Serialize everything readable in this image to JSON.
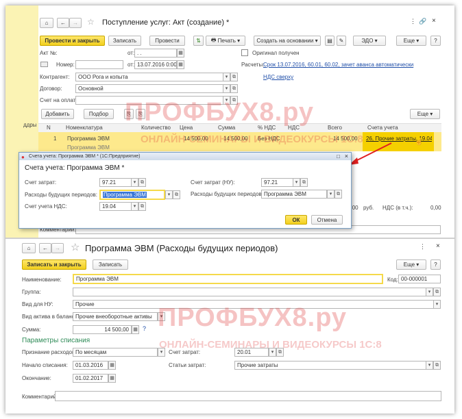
{
  "colors": {
    "accent": "#f2cf1d",
    "link": "#1f4ea8",
    "section": "#2e8b57",
    "watermark": "#dc2828"
  },
  "watermark": {
    "brand": "ПРОФБУХ8.ру",
    "tagline": "ОНЛАЙН-СЕМИНАРЫ И ВИДЕОКУРСЫ 1С:8"
  },
  "sidebar": {
    "label": "ддры"
  },
  "doc": {
    "title": "Поступление услуг: Акт (создание) *",
    "toolbar": {
      "post_close": "Провести и закрыть",
      "write": "Записать",
      "post": "Провести",
      "print": "Печать",
      "create_based": "Создать на основании",
      "edo": "ЭДО",
      "more": "Еще",
      "help": "?"
    },
    "fields": {
      "act_no_label": "Акт №:",
      "from_label": "от:",
      "from_value": ". .",
      "number_label": "Номер:",
      "number_from_label": "от:",
      "number_from_value": "13.07.2016 0:00:00",
      "original_label": "Оригинал получен",
      "calc_label": "Расчеты:",
      "calc_value": "Срок 13.07.2016, 60.01, 60.02, зачет аванса автоматически",
      "vat_link": "НДС сверху",
      "contractor_label": "Контрагент:",
      "contractor_value": "ООО Рога и копыта",
      "contract_label": "Договор:",
      "contract_value": "Основной",
      "invoice_label": "Счет на оплату:"
    },
    "table": {
      "add": "Добавить",
      "select": "Подбор",
      "more": "Еще",
      "headers": [
        "N",
        "Номенклатура",
        "Количество",
        "Цена",
        "Сумма",
        "% НДС",
        "НДС",
        "Всего",
        "Счета учета"
      ],
      "row": {
        "n": "1",
        "name": "Программа ЭВМ",
        "qty": "",
        "price": "14 500,00",
        "sum": "14 500,00",
        "vat_rate": "Без НДС",
        "vat": "",
        "total": "14 500,00",
        "accounts": "26, Прочие затраты, 19.04, ..."
      },
      "row_sub": "Программа ЭВМ",
      "footer": {
        "total": "14 500,00",
        "currency": "руб.",
        "vat_label": "НДС (в т.ч.):",
        "vat_value": "0,00"
      }
    },
    "comment_label": "Комментарий:"
  },
  "popup": {
    "window_title": "Счета учета: Программа ЭВМ * (1С:Предприятие)",
    "title": "Счета учета: Программа ЭВМ *",
    "cost_account_label": "Счет затрат:",
    "cost_account_value": "97.21",
    "deferred_label": "Расходы будущих периодов:",
    "deferred_value": "Программа ЭВМ",
    "vat_account_label": "Счет учета НДС:",
    "vat_account_value": "19.04",
    "cost_account_nu_label": "Счет затрат (НУ):",
    "cost_account_nu_value": "97.21",
    "deferred_nu_label": "Расходы будущих периодов:",
    "deferred_nu_value": "Программа ЭВМ",
    "ok": "ОК",
    "cancel": "Отмена"
  },
  "rbp": {
    "title": "Программа ЭВМ (Расходы будущих периодов)",
    "toolbar": {
      "write_close": "Записать и закрыть",
      "write": "Записать",
      "more": "Еще",
      "help": "?"
    },
    "name_label": "Наименование:",
    "name_value": "Программа ЭВМ",
    "code_label": "Код:",
    "code_value": "00-000001",
    "group_label": "Группа:",
    "type_nu_label": "Вид для НУ:",
    "type_nu_value": "Прочие",
    "asset_type_label": "Вид актива в балансе:",
    "asset_type_value": "Прочие внеоборотные активы",
    "sum_label": "Сумма:",
    "sum_value": "14 500,00",
    "writeoff_section": "Параметры списания",
    "recognition_label": "Признание расходов:",
    "recognition_value": "По месяцам",
    "cost_account_label": "Счет затрат:",
    "cost_account_value": "20.01",
    "start_label": "Начало списания:",
    "start_value": "01.03.2016",
    "cost_item_label": "Статьи затрат:",
    "cost_item_value": "Прочие затраты",
    "end_label": "Окончание:",
    "end_value": "01.02.2017",
    "comment_label": "Комментарий:"
  }
}
